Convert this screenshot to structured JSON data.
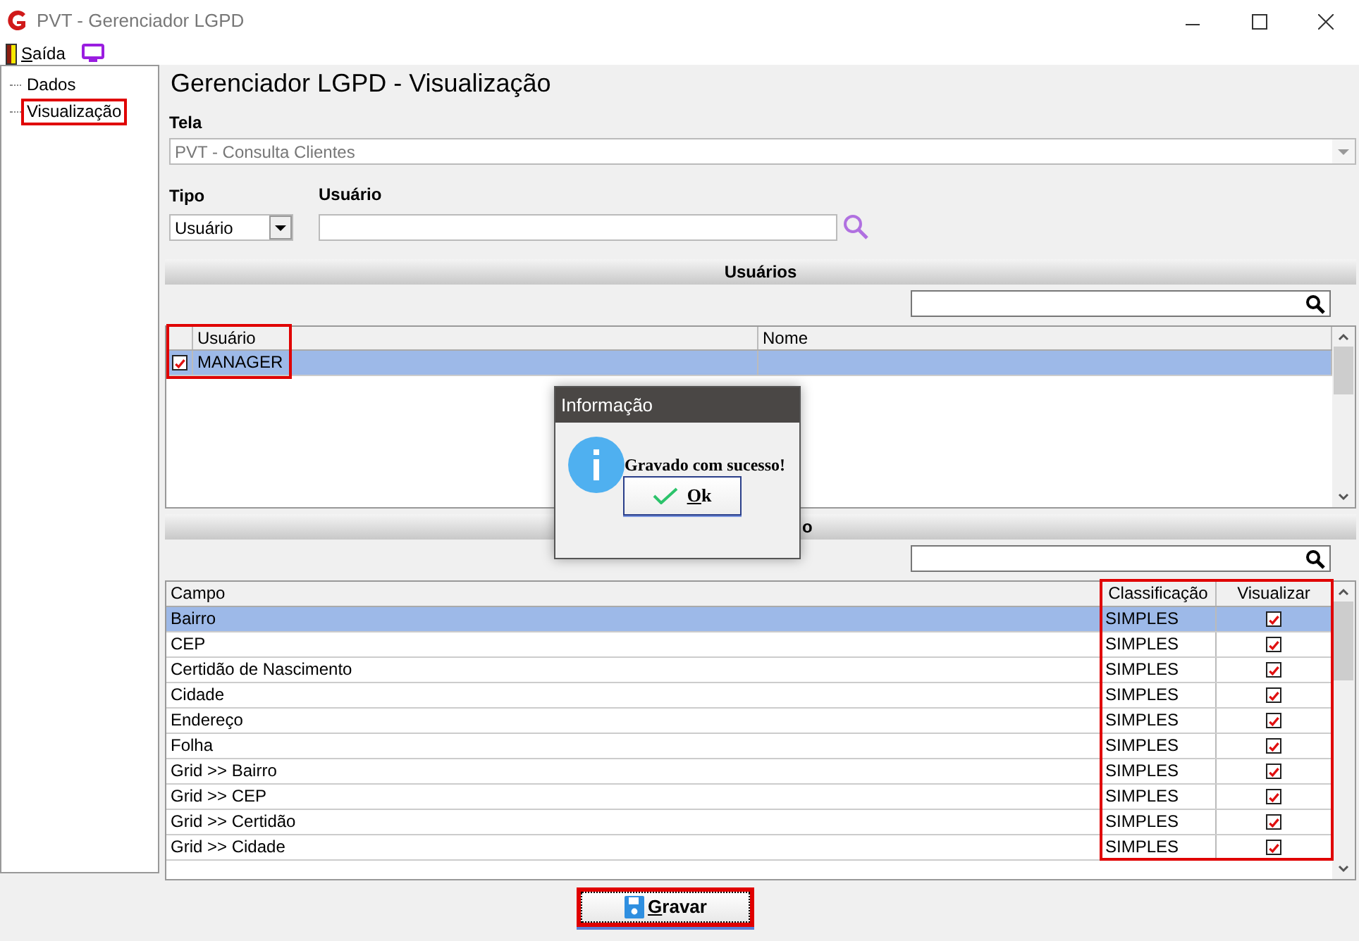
{
  "window": {
    "title": "PVT - Gerenciador LGPD"
  },
  "menu": [
    {
      "label": "Saída"
    }
  ],
  "tree": [
    {
      "label": "Dados",
      "highlight": false
    },
    {
      "label": "Visualização",
      "highlight": true
    }
  ],
  "heading": "Gerenciador LGPD - Visualização",
  "tela": {
    "label": "Tela",
    "value": "PVT - Consulta Clientes"
  },
  "tipo": {
    "label": "Tipo",
    "value": "Usuário"
  },
  "usuario": {
    "label": "Usuário"
  },
  "users_section": {
    "title": "Usuários",
    "highlight": true,
    "columns": [
      "Usuário",
      "Nome"
    ],
    "rows": [
      {
        "checked": true,
        "selected": true,
        "cells": [
          "MANAGER",
          ""
        ]
      }
    ]
  },
  "fields_section": {
    "title": "o",
    "highlight": true,
    "columns": [
      "Campo",
      "Classificação",
      "Visualizar"
    ],
    "rows": [
      {
        "campo": "Bairro",
        "classificacao": "SIMPLES",
        "checked": true,
        "selected": true
      },
      {
        "campo": "CEP",
        "classificacao": "SIMPLES",
        "checked": true,
        "selected": false
      },
      {
        "campo": "Certidão de Nascimento",
        "classificacao": "SIMPLES",
        "checked": true,
        "selected": false
      },
      {
        "campo": "Cidade",
        "classificacao": "SIMPLES",
        "checked": true,
        "selected": false
      },
      {
        "campo": "Endereço",
        "classificacao": "SIMPLES",
        "checked": true,
        "selected": false
      },
      {
        "campo": "Folha",
        "classificacao": "SIMPLES",
        "checked": true,
        "selected": false
      },
      {
        "campo": "Grid >> Bairro",
        "classificacao": "SIMPLES",
        "checked": true,
        "selected": false
      },
      {
        "campo": "Grid >> CEP",
        "classificacao": "SIMPLES",
        "checked": true,
        "selected": false
      },
      {
        "campo": "Grid >> Certidão",
        "classificacao": "SIMPLES",
        "checked": true,
        "selected": false
      },
      {
        "campo": "Grid >> Cidade",
        "classificacao": "SIMPLES",
        "checked": true,
        "selected": false
      }
    ]
  },
  "save_button": {
    "label": "Gravar",
    "highlight": true
  },
  "dialog": {
    "title": "Informação",
    "message": "Gravado com sucesso!",
    "button": "Ok"
  }
}
